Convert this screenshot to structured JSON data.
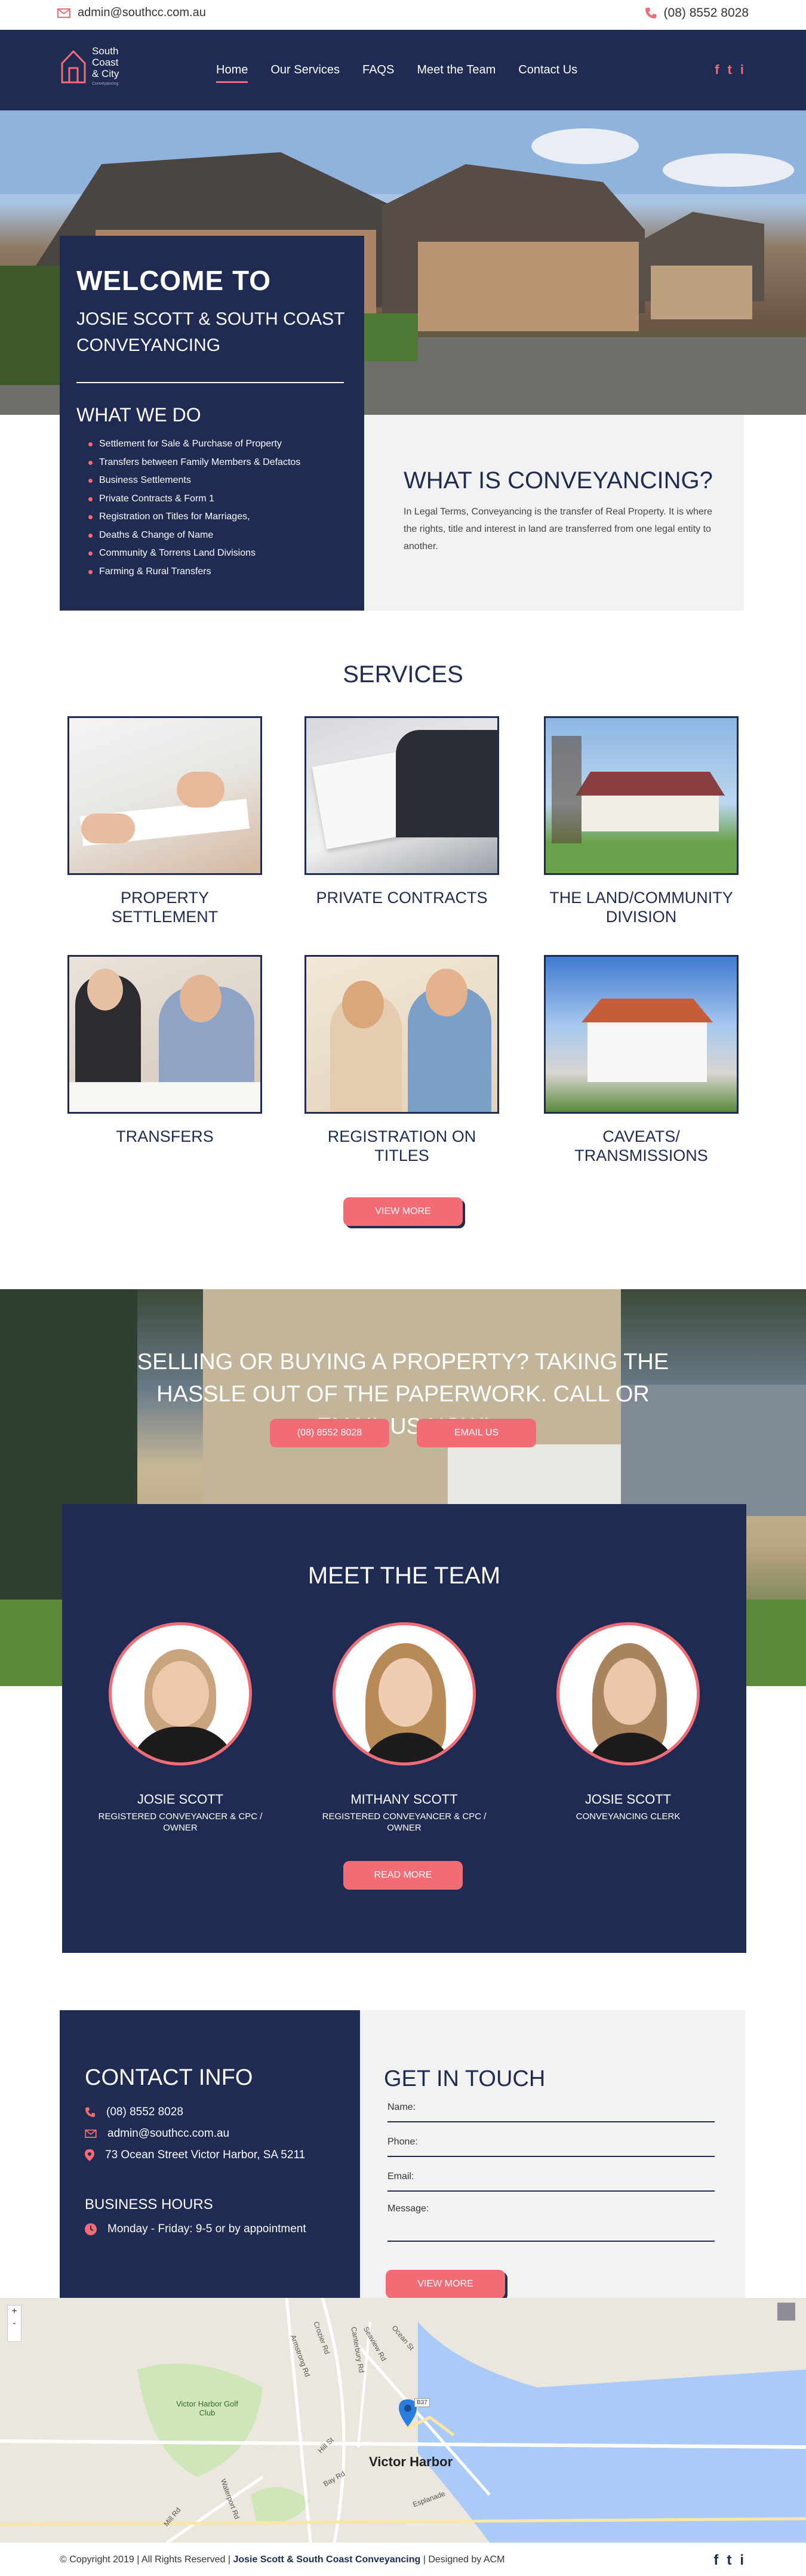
{
  "topbar": {
    "email": "admin@southcc.com.au",
    "phone": "(08) 8552 8028"
  },
  "logo": {
    "line1": "South",
    "line2": "Coast",
    "line3": "& City",
    "tagline": "Conveyancing"
  },
  "nav": {
    "items": [
      "Home",
      "Our Services",
      "FAQS",
      "Meet the Team",
      "Contact Us"
    ]
  },
  "social": {
    "facebook": "f",
    "twitter": "t",
    "instagram": "i"
  },
  "welcome": {
    "heading": "WELCOME TO",
    "subheading": "JOSIE SCOTT & SOUTH COAST CONVEYANCING",
    "what_we_do": "WHAT WE DO",
    "items": [
      "Settlement for Sale & Purchase of Property",
      "Transfers between Family Members & Defactos",
      "Business Settlements",
      "Private Contracts & Form 1",
      "Registration on Titles for Marriages,",
      "Deaths & Change of Name",
      "Community & Torrens Land Divisions",
      "Farming & Rural Transfers"
    ]
  },
  "whatis": {
    "title": "WHAT IS CONVEYANCING?",
    "body": "In Legal Terms, Conveyancing is the transfer of Real Property. It is where the rights, title and interest in land are transferred from one legal entity to another."
  },
  "services": {
    "title": "SERVICES",
    "items": [
      {
        "label": "PROPERTY SETTLEMENT"
      },
      {
        "label": "PRIVATE CONTRACTS"
      },
      {
        "label": "THE LAND/COMMUNITY DIVISION"
      },
      {
        "label": "TRANSFERS"
      },
      {
        "label": "REGISTRATION ON TITLES"
      },
      {
        "label": "CAVEATS/ TRANSMISSIONS"
      }
    ],
    "button": "VIEW MORE"
  },
  "cta": {
    "text": "SELLING OR BUYING A PROPERTY? TAKING THE HASSLE OUT OF THE PAPERWORK. CALL OR EMAIL US NOW!",
    "phone_button": "(08) 8552 8028",
    "email_button": "EMAIL US"
  },
  "team": {
    "title": "MEET THE TEAM",
    "members": [
      {
        "name": "JOSIE SCOTT",
        "role": "REGISTERED CONVEYANCER & CPC / OWNER"
      },
      {
        "name": "MITHANY SCOTT",
        "role": "REGISTERED CONVEYANCER & CPC / OWNER"
      },
      {
        "name": "JOSIE SCOTT",
        "role": "CONVEYANCING CLERK"
      }
    ],
    "button": "READ MORE"
  },
  "contact": {
    "title": "CONTACT INFO",
    "phone": "(08) 8552 8028",
    "email": "admin@southcc.com.au",
    "address": "73 Ocean Street Victor Harbor, SA 5211",
    "hours_title": "BUSINESS HOURS",
    "hours": "Monday - Friday: 9-5 or by appointment"
  },
  "form": {
    "title": "GET IN TOUCH",
    "name_label": "Name:",
    "phone_label": "Phone:",
    "email_label": "Email:",
    "message_label": "Message:",
    "submit": "VIEW MORE"
  },
  "map": {
    "city": "Victor Harbor",
    "golf": "Victor Harbor Golf Club",
    "zoom_in": "+",
    "zoom_out": "-",
    "roads": [
      "Armstrong Rd",
      "Crozier Rd",
      "Canterbury Rd",
      "Seaview Rd",
      "Mill Rd",
      "Waterport Rd",
      "Esplanade",
      "Ocean St",
      "Hill St",
      "Bay Rd"
    ],
    "route_badge": "B37"
  },
  "footer": {
    "copyright": "© Copyright 2019 | All Rights Reserved |",
    "company": "Josie Scott & South Coast Conveyancing",
    "designed": "| Designed by ACM"
  },
  "colors": {
    "navy": "#1f2b52",
    "accent": "#f26c76",
    "light": "#f2f2f2"
  }
}
